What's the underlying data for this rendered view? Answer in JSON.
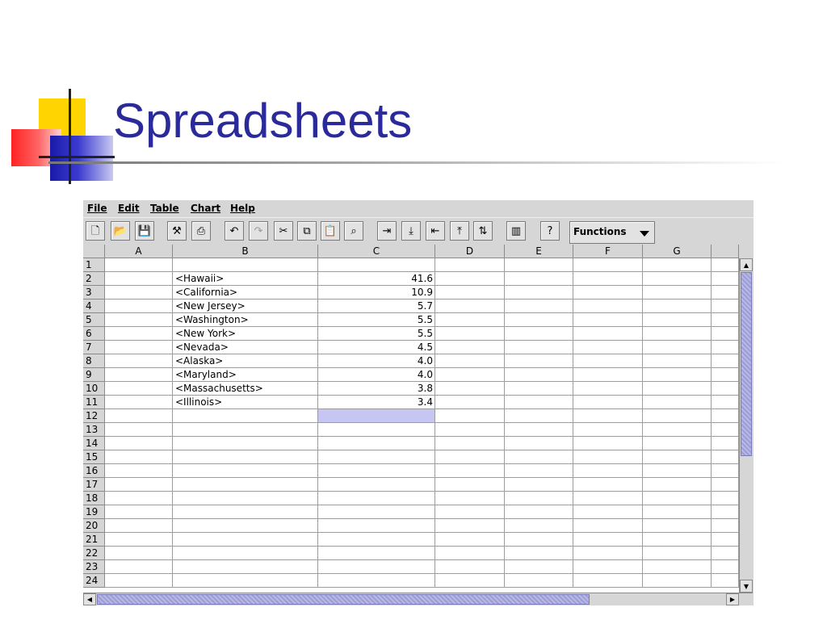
{
  "slide": {
    "title": "Spreadsheets"
  },
  "menu": [
    "File",
    "Edit",
    "Table",
    "Chart",
    "Help"
  ],
  "toolbar": {
    "buttons": [
      {
        "name": "new-document-icon",
        "glyph": "🗋",
        "disabled": false
      },
      {
        "name": "open-folder-icon",
        "glyph": "📂",
        "disabled": false
      },
      {
        "name": "save-disk-icon",
        "glyph": "💾",
        "disabled": true
      },
      {
        "name": "wizard-tool-icon",
        "glyph": "⚒",
        "disabled": false
      },
      {
        "name": "print-icon",
        "glyph": "⎙",
        "disabled": false
      },
      {
        "name": "undo-icon",
        "glyph": "↶",
        "disabled": false
      },
      {
        "name": "redo-icon",
        "glyph": "↷",
        "disabled": true
      },
      {
        "name": "cut-scissors-icon",
        "glyph": "✂",
        "disabled": false
      },
      {
        "name": "copy-icon",
        "glyph": "⧉",
        "disabled": false
      },
      {
        "name": "paste-icon",
        "glyph": "📋",
        "disabled": false
      },
      {
        "name": "find-binoculars-icon",
        "glyph": "⌕",
        "disabled": false
      },
      {
        "name": "insert-column-icon",
        "glyph": "⇥",
        "disabled": false
      },
      {
        "name": "insert-row-icon",
        "glyph": "⤓",
        "disabled": false
      },
      {
        "name": "delete-column-icon",
        "glyph": "⇤",
        "disabled": false
      },
      {
        "name": "delete-row-icon",
        "glyph": "⤒",
        "disabled": false
      },
      {
        "name": "sort-ascending-icon",
        "glyph": "⇅",
        "disabled": false
      },
      {
        "name": "chart-icon",
        "glyph": "▥",
        "disabled": false
      },
      {
        "name": "help-icon",
        "glyph": "?",
        "disabled": false
      }
    ],
    "functions_label": "Functions"
  },
  "grid": {
    "columns": [
      "A",
      "B",
      "C",
      "D",
      "E",
      "F",
      "G"
    ],
    "row_numbers": [
      "1",
      "2",
      "3",
      "4",
      "5",
      "6",
      "7",
      "8",
      "9",
      "10",
      "11",
      "12",
      "13",
      "14",
      "15",
      "16",
      "17",
      "18",
      "19",
      "20",
      "21",
      "22",
      "23",
      "24"
    ],
    "rows": [
      {
        "b": "",
        "c": ""
      },
      {
        "b": "<Hawaii>",
        "c": "41.6"
      },
      {
        "b": "<California>",
        "c": "10.9"
      },
      {
        "b": "<New Jersey>",
        "c": "5.7"
      },
      {
        "b": "<Washington>",
        "c": "5.5"
      },
      {
        "b": "<New York>",
        "c": "5.5"
      },
      {
        "b": "<Nevada>",
        "c": "4.5"
      },
      {
        "b": "<Alaska>",
        "c": "4.0"
      },
      {
        "b": "<Maryland>",
        "c": "4.0"
      },
      {
        "b": "<Massachusetts>",
        "c": "3.8"
      },
      {
        "b": "<Illinois>",
        "c": "3.4"
      },
      {
        "b": "",
        "c": "",
        "selected": true
      },
      {
        "b": "",
        "c": ""
      },
      {
        "b": "",
        "c": ""
      },
      {
        "b": "",
        "c": ""
      },
      {
        "b": "",
        "c": ""
      },
      {
        "b": "",
        "c": ""
      },
      {
        "b": "",
        "c": ""
      },
      {
        "b": "",
        "c": ""
      },
      {
        "b": "",
        "c": ""
      },
      {
        "b": "",
        "c": ""
      },
      {
        "b": "",
        "c": ""
      },
      {
        "b": "",
        "c": ""
      },
      {
        "b": "",
        "c": ""
      }
    ],
    "selection_color": "#c6c6f2"
  },
  "colors": {
    "title": "#2a2a9a",
    "chrome": "#d6d6d6",
    "scroll_thumb": "#b8b8e6"
  }
}
